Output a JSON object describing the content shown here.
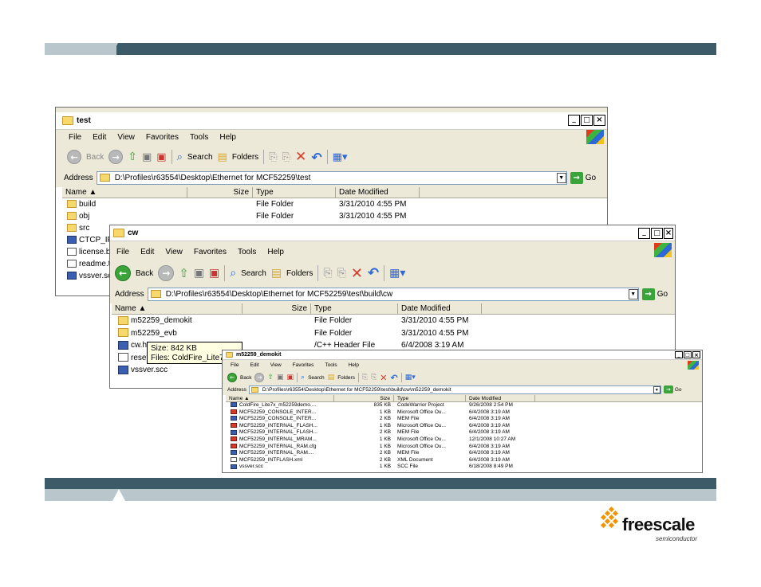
{
  "brand": {
    "colors": {
      "bar_dark": "#3c5a68",
      "bar_light": "#b9c6cc",
      "logo_orange": "#f29400"
    },
    "logo": {
      "name": "freescale",
      "sub": "semiconductor"
    }
  },
  "win1": {
    "title": "test",
    "menu": [
      "File",
      "Edit",
      "View",
      "Favorites",
      "Tools",
      "Help"
    ],
    "toolbar": {
      "back": "Back",
      "search": "Search",
      "folders": "Folders"
    },
    "address_label": "Address",
    "address": "D:\\Profiles\\r63554\\Desktop\\Ethernet for MCF52259\\test",
    "go": "Go",
    "columns": [
      "Name",
      "Size",
      "Type",
      "Date Modified"
    ],
    "rows": [
      {
        "name": "build",
        "size": "",
        "type": "File Folder",
        "date": "3/31/2010 4:55 PM",
        "icon": "folder-icon"
      },
      {
        "name": "obj",
        "size": "",
        "type": "File Folder",
        "date": "3/31/2010 4:55 PM",
        "icon": "folder-icon"
      },
      {
        "name": "src",
        "size": "",
        "type": "",
        "date": "",
        "icon": "folder-icon"
      },
      {
        "name": "CTCP_IP",
        "size": "",
        "type": "",
        "date": "",
        "icon": "project-icon"
      },
      {
        "name": "license.b",
        "size": "",
        "type": "",
        "date": "",
        "icon": "text-file-icon"
      },
      {
        "name": "readme.t",
        "size": "",
        "type": "",
        "date": "",
        "icon": "text-file-icon"
      },
      {
        "name": "vssver.sc",
        "size": "",
        "type": "",
        "date": "",
        "icon": "scc-file-icon"
      }
    ]
  },
  "win2": {
    "title": "cw",
    "menu": [
      "File",
      "Edit",
      "View",
      "Favorites",
      "Tools",
      "Help"
    ],
    "toolbar": {
      "back": "Back",
      "search": "Search",
      "folders": "Folders"
    },
    "address_label": "Address",
    "address": "D:\\Profiles\\r63554\\Desktop\\Ethernet for MCF52259\\test\\build\\cw",
    "go": "Go",
    "columns": [
      "Name",
      "Size",
      "Type",
      "Date Modified"
    ],
    "rows": [
      {
        "name": "m52259_demokit",
        "size": "",
        "type": "File Folder",
        "date": "3/31/2010 4:55 PM",
        "icon": "folder-icon"
      },
      {
        "name": "m52259_evb",
        "size": "",
        "type": "File Folder",
        "date": "3/31/2010 4:55 PM",
        "icon": "folder-icon"
      },
      {
        "name": "cw.h",
        "size": "",
        "type": "/C++ Header File",
        "date": "6/4/2008 3:19 AM",
        "icon": "header-file-icon"
      },
      {
        "name": "reset",
        "size": "",
        "type": "",
        "date": "",
        "icon": "file-icon"
      },
      {
        "name": "vssver.scc",
        "size": "",
        "type": "",
        "date": "",
        "icon": "scc-file-icon"
      }
    ],
    "tooltip": {
      "line1": "Size: 842 KB",
      "line2": "Files: ColdFire_Lite7"
    }
  },
  "win3": {
    "title": "m52259_demokit",
    "menu": [
      "File",
      "Edit",
      "View",
      "Favorites",
      "Tools",
      "Help"
    ],
    "toolbar": {
      "back": "Back",
      "search": "Search",
      "folders": "Folders"
    },
    "address_label": "Address",
    "address": "D:\\Profiles\\r63554\\Desktop\\Ethernet for MCF52259\\test\\build\\cw\\m52259_demokit",
    "go": "Go",
    "columns": [
      "Name",
      "Size",
      "Type",
      "Date Modified"
    ],
    "rows": [
      {
        "name": "ColdFire_Lite7x_m52259demo....",
        "size": "835 KB",
        "type": "CodeWarrior Project",
        "date": "9/26/2008 2:54 PM",
        "icon": "project-icon"
      },
      {
        "name": "MCF52259_CONSOLE_INTER...",
        "size": "1 KB",
        "type": "Microsoft Office Ou...",
        "date": "6/4/2008 3:19 AM",
        "icon": "office-icon"
      },
      {
        "name": "MCF52259_CONSOLE_INTER...",
        "size": "2 KB",
        "type": "MEM File",
        "date": "6/4/2008 3:19 AM",
        "icon": "mem-icon"
      },
      {
        "name": "MCF52259_INTERNAL_FLASH...",
        "size": "1 KB",
        "type": "Microsoft Office Ou...",
        "date": "6/4/2008 3:19 AM",
        "icon": "office-icon"
      },
      {
        "name": "MCF52259_INTERNAL_FLASH...",
        "size": "2 KB",
        "type": "MEM File",
        "date": "6/4/2008 3:19 AM",
        "icon": "mem-icon"
      },
      {
        "name": "MCF52259_INTERNAL_MRAM...",
        "size": "1 KB",
        "type": "Microsoft Office Ou...",
        "date": "12/1/2008 10:27 AM",
        "icon": "office-icon"
      },
      {
        "name": "MCF52259_INTERNAL_RAM.cfg",
        "size": "1 KB",
        "type": "Microsoft Office Ou...",
        "date": "6/4/2008 3:19 AM",
        "icon": "office-icon"
      },
      {
        "name": "MCF52259_INTERNAL_RAM....",
        "size": "2 KB",
        "type": "MEM File",
        "date": "6/4/2008 3:19 AM",
        "icon": "mem-icon"
      },
      {
        "name": "MCF52259_INTFLASH.xml",
        "size": "2 KB",
        "type": "XML Document",
        "date": "6/4/2008 3:19 AM",
        "icon": "xml-icon"
      },
      {
        "name": "vssver.scc",
        "size": "1 KB",
        "type": "SCC File",
        "date": "6/18/2008 8:49 PM",
        "icon": "scc-file-icon"
      }
    ]
  }
}
